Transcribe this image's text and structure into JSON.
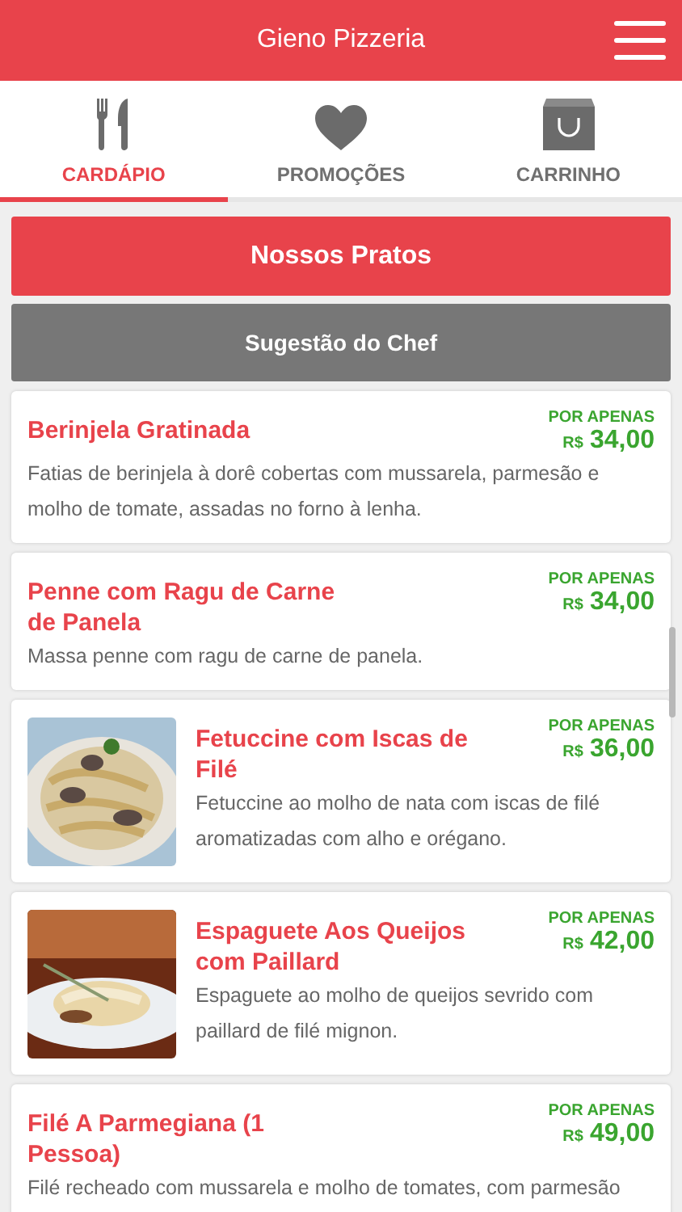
{
  "header": {
    "title": "Gieno Pizzeria"
  },
  "tabs": [
    {
      "label": "CARDÁPIO",
      "selected": true
    },
    {
      "label": "PROMOÇÕES",
      "selected": false
    },
    {
      "label": "CARRINHO",
      "selected": false
    }
  ],
  "sections": [
    {
      "label": "Nossos Pratos",
      "selected": true
    },
    {
      "label": "Sugestão do Chef",
      "selected": false
    }
  ],
  "dishes": [
    {
      "kind": "plain",
      "name": "Berinjela Gratinada",
      "price_label": "POR APENAS",
      "currency": "R$",
      "price": "34,00",
      "description": "Fatias de berinjela à dorê cobertas com mussarela, parmesão e molho de tomate, assadas no forno à lenha."
    },
    {
      "kind": "plain",
      "name": "Penne com Ragu de Carne de Panela",
      "price_label": "POR APENAS",
      "currency": "R$",
      "price": "34,00",
      "description": "Massa penne com ragu de carne de panela."
    },
    {
      "name": "Fetuccine com Iscas de Filé",
      "price_label": "POR APENAS",
      "currency": "R$",
      "price": "36,00",
      "description": "Fetuccine ao molho de nata com iscas de filé aromatizadas com alho e orégano."
    },
    {
      "name": "Espaguete Aos Queijos com Paillard",
      "price_label": "POR APENAS",
      "currency": "R$",
      "price": "42,00",
      "description": "Espaguete ao molho de queijos sevrido com paillard de filé mignon."
    },
    {
      "kind": "plain",
      "name": "Filé A Parmegiana (1 Pessoa)",
      "price_label": "POR APENAS",
      "currency": "R$",
      "price": "49,00",
      "description": "Filé recheado com mussarela e molho de tomates, com parmesão"
    }
  ]
}
